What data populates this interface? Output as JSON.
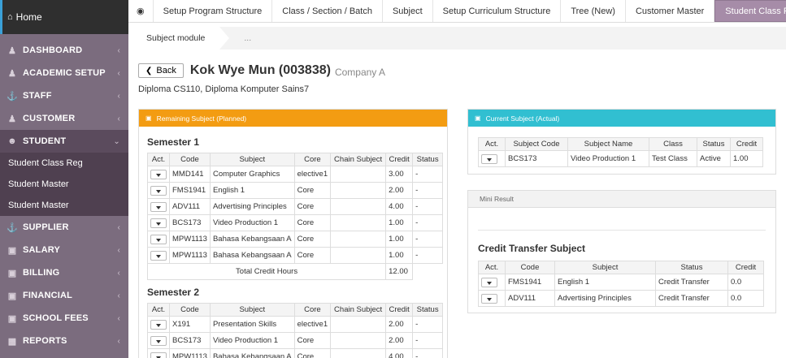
{
  "sidebar": {
    "home": "Home",
    "items": [
      {
        "label": "DASHBOARD",
        "icon": "users-icon"
      },
      {
        "label": "ACADEMIC SETUP",
        "icon": "users-icon"
      },
      {
        "label": "STAFF",
        "icon": "anchor-icon"
      },
      {
        "label": "CUSTOMER",
        "icon": "users-icon"
      },
      {
        "label": "STUDENT",
        "icon": "user-icon"
      },
      {
        "label": "SUPPLIER",
        "icon": "anchor-icon"
      },
      {
        "label": "SALARY",
        "icon": "money-icon"
      },
      {
        "label": "BILLING",
        "icon": "money-icon"
      },
      {
        "label": "FINANCIAL",
        "icon": "money-icon"
      },
      {
        "label": "SCHOOL FEES",
        "icon": "money-icon"
      },
      {
        "label": "REPORTS",
        "icon": "chart-icon"
      }
    ],
    "student_sub": [
      "Student Class Reg",
      "Student Master",
      "Student Master"
    ]
  },
  "tabs": [
    "Setup Program Structure",
    "Class / Section / Batch",
    "Subject",
    "Setup Curriculum Structure",
    "Tree (New)",
    "Customer Master",
    "Student Class Reg"
  ],
  "breadcrumb": {
    "first": "Subject module",
    "second": "..."
  },
  "header": {
    "back": "Back",
    "student_name": "Kok Wye Mun (003838)",
    "company": "Company A",
    "programs": "Diploma CS110, Diploma Komputer Sains7"
  },
  "remaining": {
    "title": "Remaining Subject (Planned)",
    "columns": [
      "Act.",
      "Code",
      "Subject",
      "Core",
      "Chain Subject",
      "Credit",
      "Status"
    ],
    "semester1": {
      "title": "Semester 1",
      "rows": [
        {
          "code": "MMD141",
          "subject": "Computer Graphics",
          "core": "elective1",
          "chain": "",
          "credit": "3.00",
          "status": "-"
        },
        {
          "code": "FMS1941",
          "subject": "English 1",
          "core": "Core",
          "chain": "",
          "credit": "2.00",
          "status": "-"
        },
        {
          "code": "ADV111",
          "subject": "Advertising Principles",
          "core": "Core",
          "chain": "",
          "credit": "4.00",
          "status": "-"
        },
        {
          "code": "BCS173",
          "subject": "Video Production 1",
          "core": "Core",
          "chain": "",
          "credit": "1.00",
          "status": "-"
        },
        {
          "code": "MPW1113",
          "subject": "Bahasa Kebangsaan A",
          "core": "Core",
          "chain": "",
          "credit": "1.00",
          "status": "-"
        },
        {
          "code": "MPW1113",
          "subject": "Bahasa Kebangsaan A",
          "core": "Core",
          "chain": "",
          "credit": "1.00",
          "status": "-"
        }
      ],
      "total_label": "Total Credit Hours",
      "total_value": "12.00"
    },
    "semester2": {
      "title": "Semester 2",
      "rows": [
        {
          "code": "X191",
          "subject": "Presentation Skills",
          "core": "elective1",
          "chain": "",
          "credit": "2.00",
          "status": "-"
        },
        {
          "code": "BCS173",
          "subject": "Video Production 1",
          "core": "Core",
          "chain": "",
          "credit": "2.00",
          "status": "-"
        },
        {
          "code": "MPW1113",
          "subject": "Bahasa Kebangsaan A",
          "core": "Core",
          "chain": "",
          "credit": "4.00",
          "status": "-"
        }
      ]
    }
  },
  "current": {
    "title": "Current Subject (Actual)",
    "columns": [
      "Act.",
      "Subject Code",
      "Subject Name",
      "Class",
      "Status",
      "Credit"
    ],
    "rows": [
      {
        "code": "BCS173",
        "name": "Video Production 1",
        "class": "Test Class",
        "status": "Active",
        "credit": "1.00"
      }
    ]
  },
  "mini": {
    "title": "Mini Result",
    "ct_title": "Credit Transfer Subject",
    "columns": [
      "Act.",
      "Code",
      "Subject",
      "Status",
      "Credit"
    ],
    "rows": [
      {
        "code": "FMS1941",
        "subject": "English 1",
        "status": "Credit Transfer",
        "credit": "0.0"
      },
      {
        "code": "ADV111",
        "subject": "Advertising Principles",
        "status": "Credit Transfer",
        "credit": "0.0"
      }
    ]
  },
  "colors": {
    "sidebar": "#7b6c7e",
    "active_tab": "#a68ca8",
    "orange": "#f39c12",
    "cyan": "#31bfd1"
  }
}
